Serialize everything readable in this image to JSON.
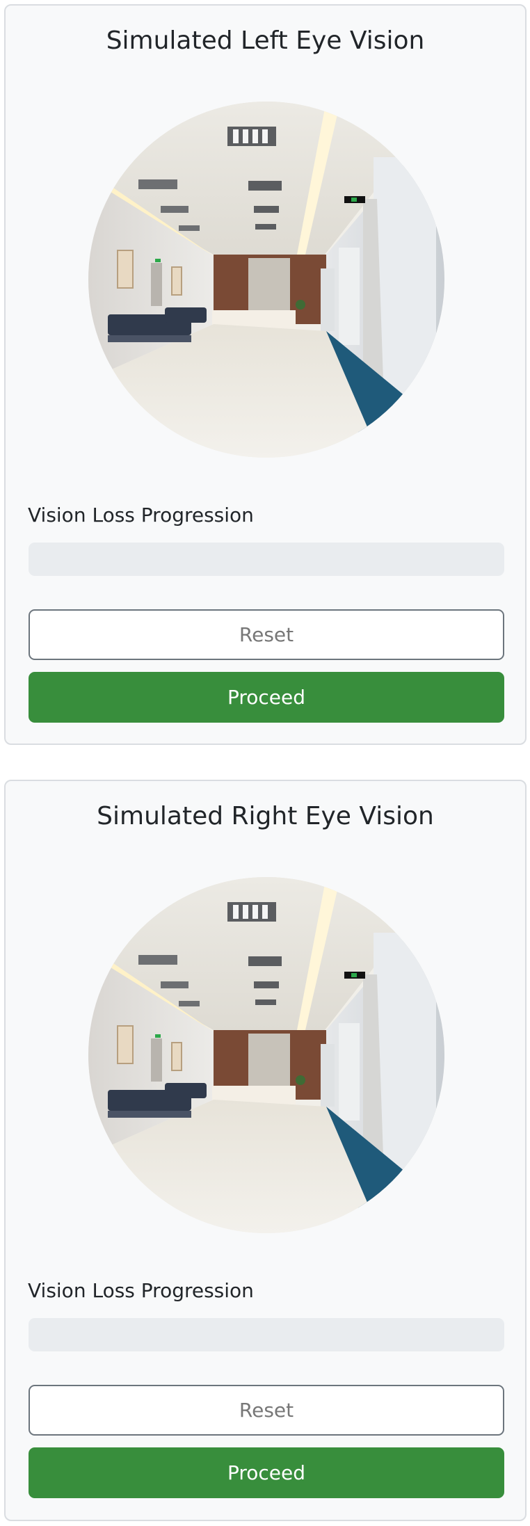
{
  "panels": [
    {
      "title": "Simulated Left Eye Vision",
      "progress_label": "Vision Loss Progression",
      "progress_value": 0,
      "reset_label": "Reset",
      "proceed_label": "Proceed"
    },
    {
      "title": "Simulated Right Eye Vision",
      "progress_label": "Vision Loss Progression",
      "progress_value": 0,
      "reset_label": "Reset",
      "proceed_label": "Proceed"
    }
  ],
  "colors": {
    "proceed": "#388e3c",
    "progress_track": "#e9ecef",
    "card_background": "#f8f9fa"
  },
  "image": {
    "subject": "hospital-corridor-scene"
  }
}
